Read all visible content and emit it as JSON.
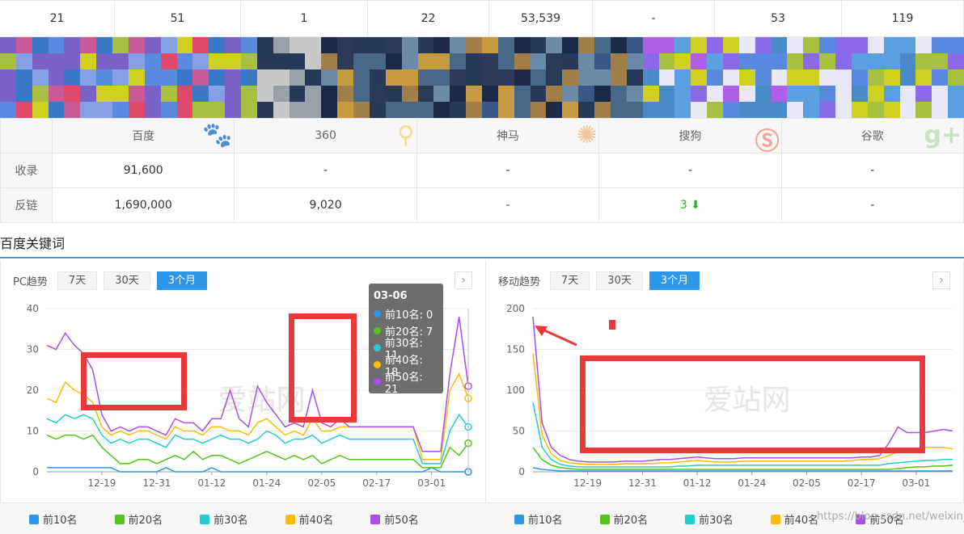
{
  "stats_row": [
    "21",
    "51",
    "1",
    "22",
    "53,539",
    "-",
    "53",
    "119"
  ],
  "engine_table": {
    "headers": [
      "百度",
      "360",
      "神马",
      "搜狗",
      "谷歌"
    ],
    "rows": [
      {
        "label": "收录",
        "values": [
          "91,600",
          "-",
          "-",
          "-",
          "-"
        ]
      },
      {
        "label": "反链",
        "values": [
          "1,690,000",
          "9,020",
          "-",
          "3",
          "-"
        ]
      }
    ],
    "down_arrow": "⬇"
  },
  "section_title": "百度关键词",
  "pc_panel": {
    "title": "PC趋势",
    "ranges": [
      "7天",
      "30天",
      "3个月"
    ],
    "active_range": "3个月",
    "next_icon": "›"
  },
  "mobile_panel": {
    "title": "移动趋势",
    "ranges": [
      "7天",
      "30天",
      "3个月"
    ],
    "active_range": "3个月",
    "next_icon": "›"
  },
  "watermark_text": "爱站网",
  "tooltip": {
    "date": "03-06",
    "rows": [
      {
        "label": "前10名: 0",
        "color": "#2d96e8"
      },
      {
        "label": "前20名: 7",
        "color": "#52c41a"
      },
      {
        "label": "前30名: 11",
        "color": "#25ccd0"
      },
      {
        "label": "前40名: 18",
        "color": "#fbbd08"
      },
      {
        "label": "前50名: 21",
        "color": "#a94ee6"
      }
    ]
  },
  "legend": [
    {
      "name": "前10名",
      "color": "#2d96e8"
    },
    {
      "name": "前20名",
      "color": "#52c41a"
    },
    {
      "name": "前30名",
      "color": "#25ccd0"
    },
    {
      "name": "前40名",
      "color": "#fbbd08"
    },
    {
      "name": "前50名",
      "color": "#a94ee6"
    }
  ],
  "csdn_watermark": "https://blog.csdn.net/weixin_44...",
  "chart_data": [
    {
      "type": "line",
      "title": "",
      "x_ticks": [
        "12-19",
        "12-31",
        "01-12",
        "01-24",
        "02-05",
        "02-17",
        "03-01"
      ],
      "ylim": [
        0,
        40
      ],
      "y_ticks": [
        0,
        10,
        20,
        30,
        40
      ],
      "grid": true,
      "series": [
        {
          "name": "前10名",
          "color": "#2d96e8",
          "values": [
            1,
            1,
            1,
            1,
            1,
            1,
            1,
            1,
            0,
            0,
            0,
            0,
            0,
            1,
            0,
            0,
            0,
            0,
            1,
            0,
            0,
            0,
            0,
            0,
            0,
            0,
            0,
            0,
            0,
            0,
            0,
            0,
            0,
            0,
            0,
            0,
            0,
            0,
            0,
            0,
            0,
            0,
            1,
            0,
            0,
            0,
            0
          ]
        },
        {
          "name": "前20名",
          "color": "#52c41a",
          "values": [
            9,
            8,
            9,
            9,
            8,
            9,
            6,
            4,
            2,
            2,
            3,
            3,
            2,
            3,
            4,
            3,
            5,
            3,
            4,
            4,
            3,
            2,
            3,
            4,
            5,
            4,
            3,
            4,
            3,
            4,
            2,
            3,
            4,
            3,
            3,
            3,
            3,
            3,
            3,
            3,
            3,
            1,
            1,
            1,
            6,
            4,
            7
          ]
        },
        {
          "name": "前30名",
          "color": "#25ccd0",
          "values": [
            13,
            12,
            14,
            13,
            14,
            13,
            9,
            7,
            8,
            7,
            8,
            8,
            7,
            6,
            9,
            8,
            8,
            7,
            8,
            9,
            8,
            8,
            7,
            8,
            10,
            9,
            7,
            8,
            8,
            9,
            7,
            8,
            9,
            8,
            8,
            8,
            8,
            8,
            8,
            8,
            8,
            2,
            2,
            2,
            10,
            14,
            11
          ]
        },
        {
          "name": "前40名",
          "color": "#fbbd08",
          "values": [
            18,
            17,
            22,
            20,
            19,
            17,
            11,
            9,
            10,
            9,
            10,
            10,
            9,
            8,
            11,
            10,
            10,
            9,
            11,
            11,
            10,
            10,
            9,
            12,
            13,
            11,
            9,
            10,
            9,
            13,
            10,
            10,
            11,
            11,
            11,
            11,
            11,
            11,
            11,
            11,
            11,
            3,
            3,
            3,
            20,
            24,
            18
          ]
        },
        {
          "name": "前50名",
          "color": "#a94ee6",
          "values": [
            31,
            30,
            34,
            31,
            29,
            25,
            14,
            10,
            11,
            10,
            11,
            11,
            10,
            9,
            13,
            12,
            12,
            10,
            13,
            13,
            20,
            13,
            11,
            21,
            17,
            14,
            11,
            12,
            11,
            20,
            12,
            11,
            13,
            11,
            11,
            11,
            11,
            11,
            11,
            11,
            11,
            5,
            5,
            5,
            24,
            38,
            21
          ]
        }
      ]
    },
    {
      "type": "line",
      "title": "",
      "x_ticks": [
        "12-19",
        "12-31",
        "01-12",
        "01-24",
        "02-05",
        "02-17",
        "03-01"
      ],
      "ylim": [
        0,
        200
      ],
      "y_ticks": [
        0,
        50,
        100,
        150,
        200
      ],
      "grid": true,
      "series": [
        {
          "name": "前10名",
          "color": "#2d96e8",
          "values": [
            5,
            3,
            2,
            1,
            1,
            1,
            1,
            1,
            1,
            1,
            1,
            1,
            1,
            1,
            1,
            1,
            1,
            1,
            1,
            1,
            1,
            1,
            1,
            1,
            1,
            1,
            1,
            1,
            1,
            1,
            1,
            1,
            1,
            1,
            1,
            1,
            1,
            1,
            1,
            1,
            1,
            1,
            1,
            1,
            1,
            1,
            1
          ]
        },
        {
          "name": "前20名",
          "color": "#52c41a",
          "values": [
            30,
            15,
            8,
            5,
            4,
            3,
            3,
            3,
            3,
            3,
            3,
            3,
            3,
            3,
            3,
            3,
            3,
            3,
            3,
            3,
            3,
            3,
            3,
            3,
            3,
            3,
            3,
            3,
            3,
            3,
            3,
            3,
            3,
            3,
            3,
            3,
            3,
            3,
            3,
            3,
            4,
            5,
            6,
            6,
            7,
            7,
            8
          ]
        },
        {
          "name": "前30名",
          "color": "#25ccd0",
          "values": [
            85,
            30,
            15,
            9,
            7,
            6,
            6,
            6,
            6,
            6,
            6,
            6,
            6,
            6,
            6,
            6,
            7,
            7,
            8,
            8,
            8,
            8,
            8,
            8,
            8,
            8,
            8,
            8,
            8,
            8,
            8,
            8,
            8,
            8,
            8,
            8,
            8,
            8,
            8,
            10,
            11,
            12,
            13,
            14,
            14,
            15,
            15
          ]
        },
        {
          "name": "前40名",
          "color": "#fbbd08",
          "values": [
            145,
            45,
            22,
            14,
            11,
            10,
            9,
            9,
            9,
            9,
            10,
            10,
            10,
            10,
            11,
            11,
            12,
            13,
            14,
            13,
            12,
            12,
            12,
            13,
            13,
            13,
            13,
            13,
            13,
            13,
            13,
            13,
            13,
            13,
            13,
            14,
            15,
            15,
            16,
            20,
            25,
            28,
            28,
            30,
            30,
            30,
            28
          ]
        },
        {
          "name": "前50名",
          "color": "#a94ee6",
          "values": [
            190,
            60,
            30,
            20,
            15,
            13,
            12,
            12,
            12,
            12,
            13,
            13,
            13,
            14,
            15,
            15,
            16,
            17,
            18,
            17,
            16,
            16,
            16,
            17,
            17,
            17,
            17,
            17,
            17,
            17,
            17,
            17,
            17,
            17,
            17,
            17,
            18,
            18,
            20,
            35,
            55,
            48,
            48,
            48,
            50,
            52,
            50
          ]
        }
      ]
    }
  ]
}
